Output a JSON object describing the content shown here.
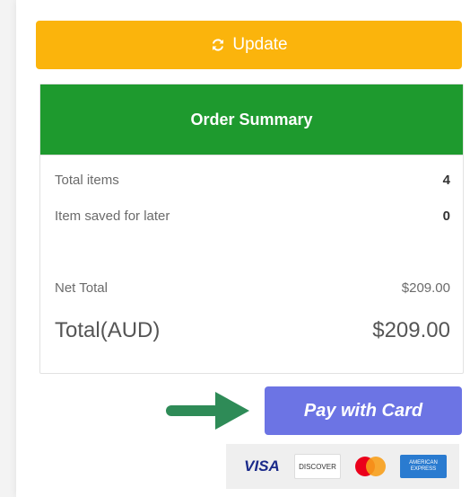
{
  "update": {
    "label": "Update",
    "icon": "refresh-icon",
    "color": "#fbb40c"
  },
  "summary": {
    "title": "Order Summary",
    "header_color": "#1e9a2e",
    "rows": [
      {
        "label": "Total items",
        "value": "4"
      },
      {
        "label": "Item saved for later",
        "value": "0"
      }
    ],
    "net_total_label": "Net Total",
    "net_total_value": "$209.00",
    "total_label": "Total(AUD)",
    "total_value": "$209.00"
  },
  "payment": {
    "pay_label": "Pay with Card",
    "pay_color": "#6c74e4",
    "cards": {
      "visa": "VISA",
      "discover": "DISCOVER",
      "mastercard": "MasterCard",
      "amex": "AMERICAN EXPRESS"
    }
  }
}
